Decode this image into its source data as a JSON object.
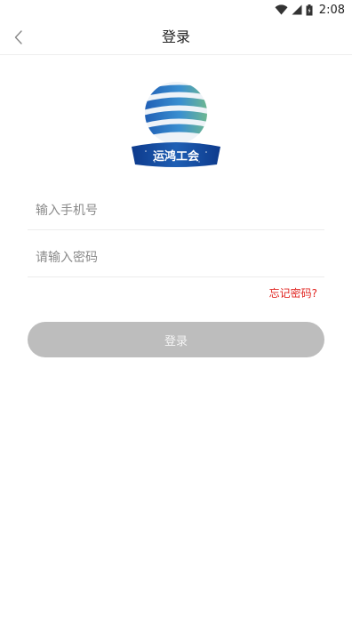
{
  "status_bar": {
    "time": "2:08",
    "icons": [
      "wifi-icon",
      "signal-icon",
      "battery-icon"
    ]
  },
  "nav": {
    "title": "登录",
    "back_icon": "chevron-left-icon"
  },
  "logo": {
    "text": "运鸿工会"
  },
  "form": {
    "phone_placeholder": "输入手机号",
    "phone_value": "",
    "password_placeholder": "请输入密码",
    "password_value": "",
    "forgot_label": "忘记密码?",
    "login_label": "登录"
  },
  "colors": {
    "forgot_link": "#e0231f",
    "login_button_disabled": "#bdbdbd",
    "logo_blue": "#1f5fb4",
    "logo_green": "#7cc37f"
  }
}
